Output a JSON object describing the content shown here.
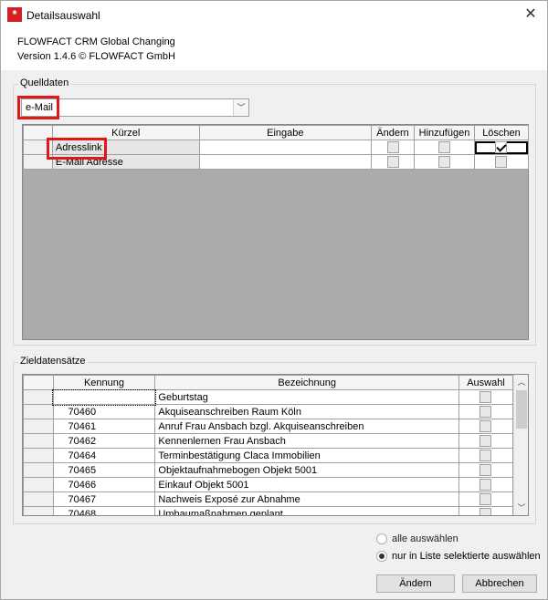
{
  "window": {
    "title": "Detailsauswahl",
    "close_glyph": "✕"
  },
  "header": {
    "product": "FLOWFACT CRM Global Changing",
    "version": "Version 1.4.6 © FLOWFACT GmbH"
  },
  "source": {
    "group_label": "Quelldaten",
    "combo_value": "e-Mail",
    "columns": [
      "Kürzel",
      "Eingabe",
      "Ändern",
      "Hinzufügen",
      "Löschen"
    ],
    "rows": [
      {
        "kuerzel": "Adresslink",
        "eingabe": "",
        "aendern": false,
        "hinzufuegen": false,
        "loeschen": true
      },
      {
        "kuerzel": "E-Mail Adresse",
        "eingabe": "",
        "aendern": false,
        "hinzufuegen": false,
        "loeschen": false
      }
    ]
  },
  "target": {
    "group_label": "Zieldatensätze",
    "columns": [
      "Kennung",
      "Bezeichnung",
      "Auswahl"
    ],
    "rows": [
      {
        "kennung": "",
        "bezeichnung": "Geburtstag"
      },
      {
        "kennung": "70460",
        "bezeichnung": "Akquiseanschreiben Raum Köln"
      },
      {
        "kennung": "70461",
        "bezeichnung": "Anruf Frau Ansbach bzgl. Akquiseanschreiben"
      },
      {
        "kennung": "70462",
        "bezeichnung": "Kennenlernen Frau Ansbach"
      },
      {
        "kennung": "70464",
        "bezeichnung": "Terminbestätigung Claca Immobilien"
      },
      {
        "kennung": "70465",
        "bezeichnung": "Objektaufnahmebogen Objekt 5001"
      },
      {
        "kennung": "70466",
        "bezeichnung": "Einkauf Objekt 5001"
      },
      {
        "kennung": "70467",
        "bezeichnung": "Nachweis Exposé zur Abnahme"
      },
      {
        "kennung": "70468",
        "bezeichnung": "Umbaumaßnahmen geplant"
      }
    ]
  },
  "options": {
    "select_all": "alle auswählen",
    "select_listed": "nur in Liste selektierte auswählen",
    "selected": "select_listed"
  },
  "buttons": {
    "ok": "Ändern",
    "cancel": "Abbrechen"
  },
  "colors": {
    "highlight": "#e01818",
    "app_icon": "#d42020"
  }
}
